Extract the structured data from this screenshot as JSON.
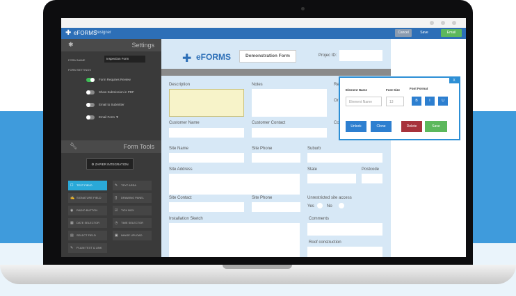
{
  "app": {
    "title": "eFORMS",
    "subtitle": "Designer"
  },
  "toolbar": {
    "cancel_label": "Cancel",
    "save_label": "Save",
    "email_label": "Email"
  },
  "sidebar": {
    "settings_title": "Settings",
    "form_name_label": "FORM NAME",
    "form_name_value": "Inspection Form",
    "form_settings_label": "FORM SETTINGS",
    "toggles": [
      {
        "label": "Form Requires Review",
        "on": true
      },
      {
        "label": "Show Submission in PDF",
        "on": false
      },
      {
        "label": "Email to Submitter",
        "on": false
      },
      {
        "label": "Email Form ▼",
        "on": false
      }
    ],
    "tools_title": "Form Tools",
    "zapier_label": "ZAPIER INTEGRATION",
    "tools": [
      {
        "label": "TEXT FIELD",
        "icon": "☐",
        "active": true
      },
      {
        "label": "TEXT AREA",
        "icon": "✎",
        "active": false
      },
      {
        "label": "SIGNATURE FIELD",
        "icon": "✍",
        "active": false
      },
      {
        "label": "DRAWING PANEL",
        "icon": "{}",
        "active": false
      },
      {
        "label": "RADIO BUTTON",
        "icon": "◉",
        "active": false
      },
      {
        "label": "TICK BOX",
        "icon": "☑",
        "active": false
      },
      {
        "label": "DATE SELECTOR",
        "icon": "▦",
        "active": false
      },
      {
        "label": "TIME SELECTOR",
        "icon": "◷",
        "active": false
      },
      {
        "label": "SELECT FIELD",
        "icon": "▤",
        "active": false
      },
      {
        "label": "IMAGE UPLOAD",
        "icon": "▣",
        "active": false
      },
      {
        "label": "PLAIN TEXT & LINK",
        "icon": "✎",
        "active": false
      }
    ]
  },
  "canvas": {
    "brand": "eFORMS",
    "form_title": "Demonstration Form",
    "project_label": "Projec ID:",
    "labels": {
      "description": "Description",
      "notes": "Notes",
      "re": "Re",
      "or": "Or",
      "customer_name": "Customer Name",
      "customer_contact": "Customer Contact",
      "co": "Co",
      "site_name": "Site Name",
      "site_phone": "Site Phone",
      "suburb": "Suburb",
      "site_address": "Site Address",
      "state": "State",
      "postcode": "Postcode",
      "site_contact": "Site Contact",
      "site_phone_2": "Site Phone",
      "unrestricted": "Unrestricted site access",
      "yes": "Yes",
      "no": "No",
      "installation_sketch": "Installation Sketch",
      "comments": "Comments",
      "roof_construction": "Roof construction"
    }
  },
  "popup": {
    "close_label": "X",
    "element_name_label": "Element Name",
    "element_name_placeholder": "Element Name",
    "font_size_label": "Font Size",
    "font_size_value": "13",
    "font_format_label": "Font Format",
    "format_buttons": [
      "B",
      "I",
      "U"
    ],
    "unlock_label": "Unlock",
    "clone_label": "Clone",
    "delete_label": "Delete",
    "save_label": "Save"
  },
  "colors": {
    "accent": "#2d6fb7",
    "active_tool": "#2aa9d8",
    "save": "#5cb85c",
    "delete": "#a7323b",
    "toggle_on": "#3fbf57"
  }
}
